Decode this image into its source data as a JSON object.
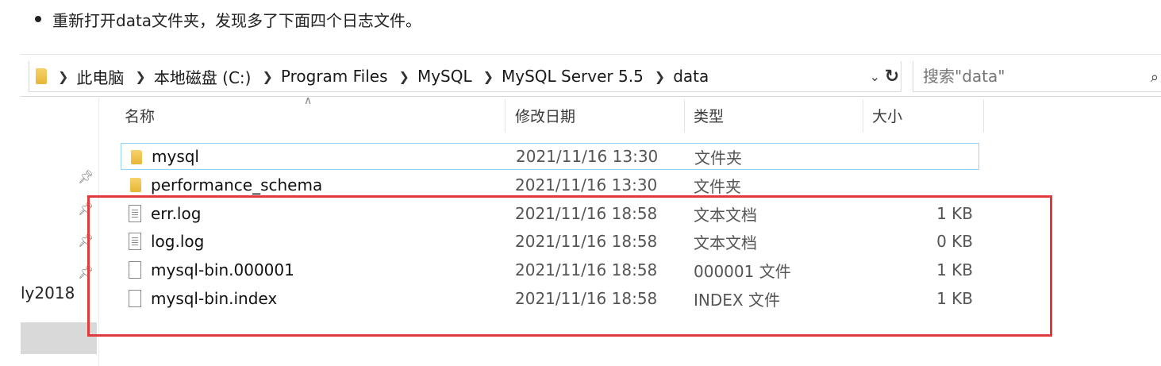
{
  "instruction_text": "重新打开data文件夹，发现多了下面四个日志文件。",
  "address": {
    "crumbs": [
      "此电脑",
      "本地磁盘 (C:)",
      "Program Files",
      "MySQL",
      "MySQL Server 5.5",
      "data"
    ]
  },
  "search": {
    "placeholder": "搜索\"data\""
  },
  "nav": {
    "partial_label": "ly2018"
  },
  "columns": {
    "name": "名称",
    "date": "修改日期",
    "type": "类型",
    "size": "大小"
  },
  "files": [
    {
      "icon": "folder-icon",
      "name": "mysql",
      "date": "2021/11/16 13:30",
      "type": "文件夹",
      "size": ""
    },
    {
      "icon": "folder-icon",
      "name": "performance_schema",
      "date": "2021/11/16 13:30",
      "type": "文件夹",
      "size": ""
    },
    {
      "icon": "text-file-icon",
      "name": "err.log",
      "date": "2021/11/16 18:58",
      "type": "文本文档",
      "size": "1 KB"
    },
    {
      "icon": "text-file-icon",
      "name": "log.log",
      "date": "2021/11/16 18:58",
      "type": "文本文档",
      "size": "0 KB"
    },
    {
      "icon": "blank-file-icon",
      "name": "mysql-bin.000001",
      "date": "2021/11/16 18:58",
      "type": "000001 文件",
      "size": "1 KB"
    },
    {
      "icon": "blank-file-icon",
      "name": "mysql-bin.index",
      "date": "2021/11/16 18:58",
      "type": "INDEX 文件",
      "size": "1 KB"
    }
  ],
  "colors": {
    "annotation_border": "#e23a3a",
    "selection_border": "#99d1ff",
    "folder": "#e8b635"
  }
}
